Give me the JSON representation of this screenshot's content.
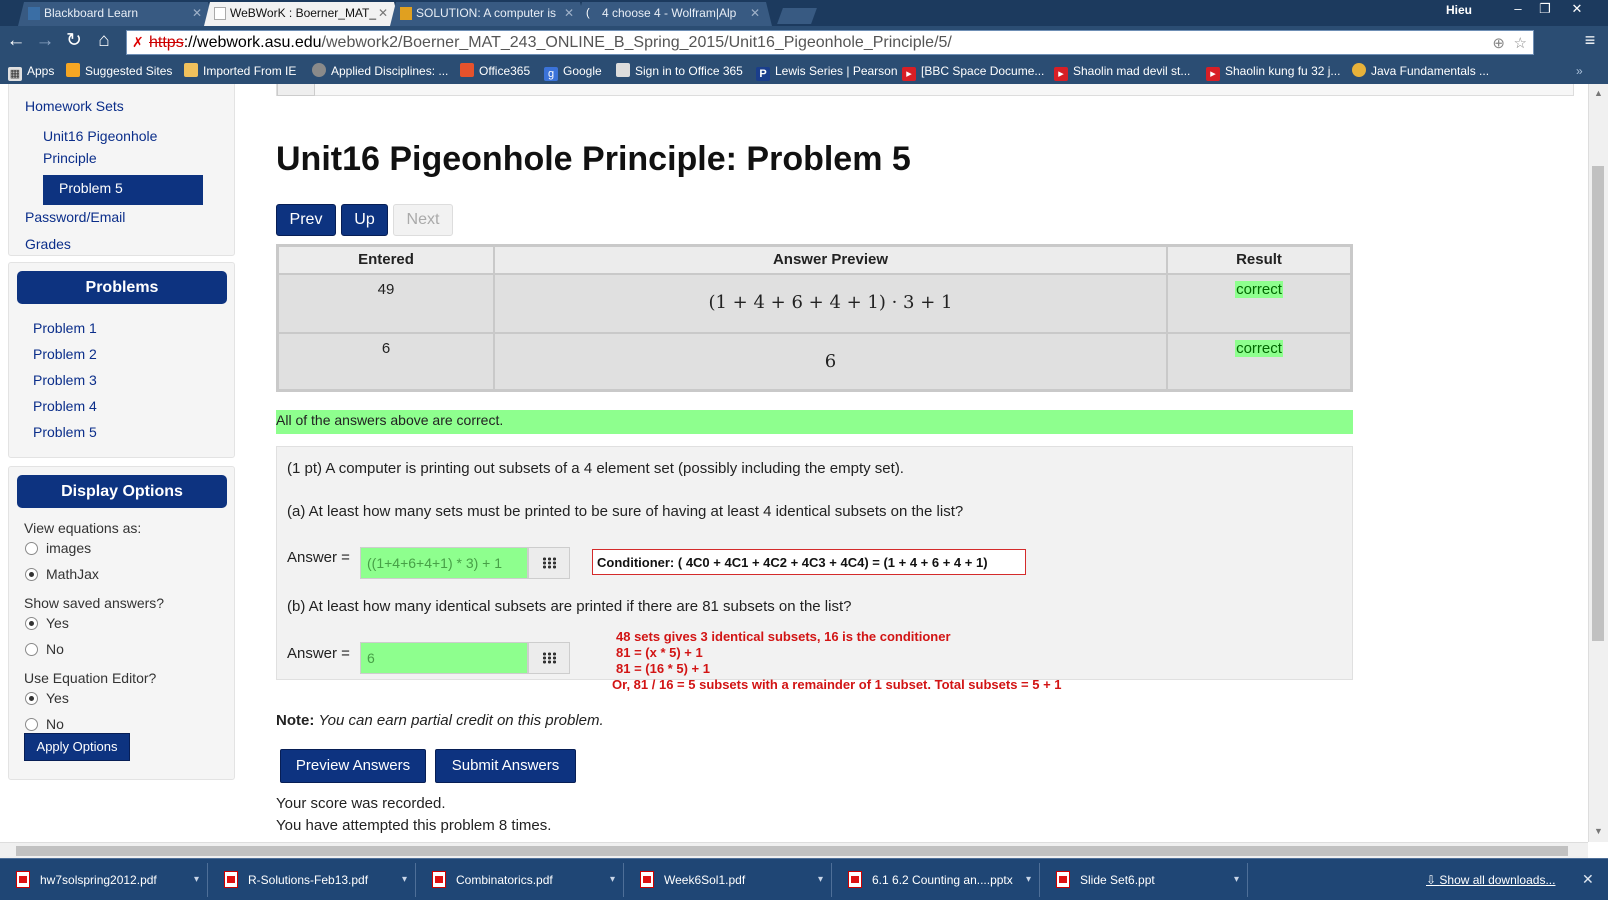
{
  "browser": {
    "tabs": [
      {
        "title": "Blackboard Learn",
        "active": false
      },
      {
        "title": "WeBWorK : Boerner_MAT_",
        "active": true
      },
      {
        "title": "SOLUTION: A computer is",
        "active": false
      },
      {
        "title": "4 choose 4 - Wolfram|Alp",
        "active": false
      }
    ],
    "user": "Hieu",
    "url_scheme": "https",
    "url_host": "://webwork.asu.edu",
    "url_path": "/webwork2/Boerner_MAT_243_ONLINE_B_Spring_2015/Unit16_Pigeonhole_Principle/5/",
    "bookmarks": [
      {
        "label": "Apps",
        "icon": "apps-icon",
        "color": "#e0e0e0"
      },
      {
        "label": "Suggested Sites",
        "icon": "suggested-sites-icon",
        "color": "#f5a623"
      },
      {
        "label": "Imported From IE",
        "icon": "folder-icon",
        "color": "#f1c15c"
      },
      {
        "label": "Applied Disciplines: ...",
        "icon": "globe-icon",
        "color": "#8a8a8a"
      },
      {
        "label": "Office365",
        "icon": "office-icon",
        "color": "#e6522c"
      },
      {
        "label": "Google",
        "icon": "google-icon",
        "color": "#3b73d9"
      },
      {
        "label": "Sign in to Office 365",
        "icon": "lock-doc-icon",
        "color": "#dddddd"
      },
      {
        "label": "Lewis Series | Pearson",
        "icon": "pearson-icon",
        "color": "#1a3e8c"
      },
      {
        "label": "[BBC Space Docume...",
        "icon": "youtube-icon",
        "color": "#d81f26"
      },
      {
        "label": "Shaolin mad devil st...",
        "icon": "youtube-icon",
        "color": "#d81f26"
      },
      {
        "label": "Shaolin kung fu 32 j...",
        "icon": "youtube-icon",
        "color": "#d81f26"
      },
      {
        "label": "Java Fundamentals ...",
        "icon": "java-icon",
        "color": "#e8b23a"
      }
    ]
  },
  "sidebar": {
    "homework_sets": "Homework Sets",
    "set_name": "Unit16 Pigeonhole Principle",
    "current_problem": "Problem 5",
    "password_email": "Password/Email",
    "grades": "Grades",
    "problems_header": "Problems",
    "problems": [
      "Problem 1",
      "Problem 2",
      "Problem 3",
      "Problem 4",
      "Problem 5"
    ],
    "display_options_header": "Display Options",
    "view_equations_label": "View equations as:",
    "view_options": [
      "images",
      "MathJax"
    ],
    "view_selected": "MathJax",
    "show_saved_label": "Show saved answers?",
    "use_editor_label": "Use Equation Editor?",
    "yes": "Yes",
    "no": "No",
    "apply_button": "Apply Options"
  },
  "main": {
    "title": "Unit16 Pigeonhole Principle: Problem 5",
    "nav": {
      "prev": "Prev",
      "up": "Up",
      "next": "Next"
    },
    "table": {
      "headers": [
        "Entered",
        "Answer Preview",
        "Result"
      ],
      "rows": [
        {
          "entered": "49",
          "preview": "(1 + 4 + 6 + 4 + 1) · 3 + 1",
          "result": "correct"
        },
        {
          "entered": "6",
          "preview": "6",
          "result": "correct"
        }
      ]
    },
    "all_correct_msg": "All of the answers above are correct.",
    "problem": {
      "intro": "(1 pt) A computer is printing out subsets of a 4 element set (possibly including the empty set).",
      "part_a": "(a) At least how many sets must be printed to be sure of having at least 4 identical subsets on the list?",
      "answer_label": "Answer =",
      "answer_a": "((1+4+6+4+1) * 3) + 1",
      "conditioner_note": "Conditioner: ( 4C0 + 4C1 + 4C2 + 4C3 + 4C4) = (1 + 4 + 6 + 4 + 1)",
      "part_b": "(b) At least how many identical subsets are printed if there are 81 subsets on the list?",
      "answer_b": "6",
      "red_notes": [
        "48 sets gives 3 identical subsets, 16 is the conditioner",
        "81 = (x * 5) + 1",
        "81 = (16 * 5) + 1",
        "Or, 81 / 16 = 5 subsets with a remainder of 1 subset. Total subsets = 5 + 1"
      ]
    },
    "note_label": "Note:",
    "note_text": "You can earn partial credit on this problem.",
    "preview_button": "Preview Answers",
    "submit_button": "Submit Answers",
    "score_recorded": "Your score was recorded.",
    "attempts": "You have attempted this problem 8 times."
  },
  "downloads": {
    "items": [
      "hw7solspring2012.pdf",
      "R-Solutions-Feb13.pdf",
      "Combinatorics.pdf",
      "Week6Sol1.pdf",
      "6.1 6.2 Counting an....pptx",
      "Slide Set6.ppt"
    ],
    "show_all": "Show all downloads..."
  },
  "colors": {
    "brand_blue": "#0d3380",
    "correct_green": "#8eff8e",
    "note_red": "#d21414",
    "chrome_dark": "#2b4d73"
  }
}
